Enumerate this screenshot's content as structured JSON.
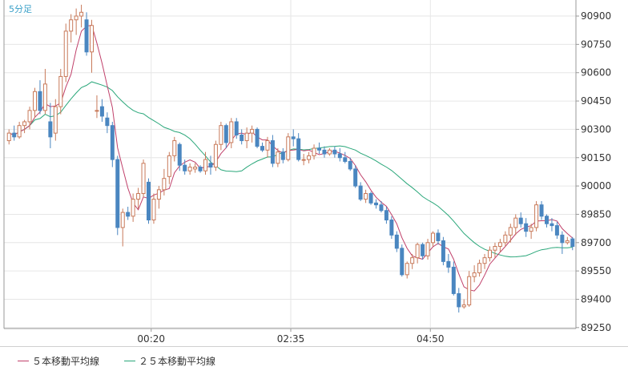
{
  "timeframe_label": "5分足",
  "legend": [
    {
      "label": "５本移動平均線",
      "color": "#c0406a"
    },
    {
      "label": "２５本移動平均線",
      "color": "#2aa77a"
    }
  ],
  "colors": {
    "up": "#c87a5a",
    "down": "#4a86c0",
    "grid": "#e6e6e6",
    "axis": "#9a9a9a"
  },
  "chart_data": {
    "type": "candlestick",
    "y_ticks": [
      90900,
      90750,
      90600,
      90450,
      90300,
      90150,
      90000,
      89850,
      89700,
      89550,
      89400,
      89250
    ],
    "ylim": [
      89245,
      90985
    ],
    "x_ticks": [
      {
        "label": "00:20",
        "index": 27.5
      },
      {
        "label": "02:35",
        "index": 54.5
      },
      {
        "label": "04:50",
        "index": 81.5
      }
    ],
    "candles": [
      [
        90240,
        90300,
        90220,
        90280
      ],
      [
        90280,
        90320,
        90240,
        90260
      ],
      [
        90260,
        90340,
        90250,
        90320
      ],
      [
        90320,
        90350,
        90280,
        90340
      ],
      [
        90340,
        90420,
        90300,
        90400
      ],
      [
        90400,
        90520,
        90360,
        90500
      ],
      [
        90500,
        90560,
        90380,
        90400
      ],
      [
        90400,
        90620,
        90380,
        90540
      ],
      [
        90340,
        90440,
        90200,
        90260
      ],
      [
        90280,
        90460,
        90240,
        90420
      ],
      [
        90420,
        90620,
        90380,
        90580
      ],
      [
        90580,
        90860,
        90550,
        90820
      ],
      [
        90820,
        90910,
        90760,
        90880
      ],
      [
        90880,
        90940,
        90800,
        90900
      ],
      [
        90900,
        90960,
        90840,
        90920
      ],
      [
        90880,
        90920,
        90690,
        90710
      ],
      [
        90710,
        90880,
        90600,
        90850
      ],
      [
        90400,
        90480,
        90360,
        90400
      ],
      [
        90420,
        90460,
        90340,
        90370
      ],
      [
        90360,
        90390,
        90280,
        90320
      ],
      [
        90320,
        90340,
        90100,
        90140
      ],
      [
        90140,
        90160,
        89740,
        89780
      ],
      [
        89780,
        89880,
        89680,
        89860
      ],
      [
        89860,
        89890,
        89820,
        89840
      ],
      [
        89840,
        89960,
        89810,
        89930
      ],
      [
        89930,
        89990,
        89880,
        89960
      ],
      [
        89960,
        90140,
        89940,
        90120
      ],
      [
        90020,
        90040,
        89800,
        89820
      ],
      [
        89820,
        89960,
        89800,
        89930
      ],
      [
        89930,
        90000,
        89880,
        89980
      ],
      [
        89980,
        90090,
        89950,
        90040
      ],
      [
        90050,
        90180,
        90010,
        90160
      ],
      [
        90160,
        90260,
        90130,
        90240
      ],
      [
        90220,
        90230,
        90080,
        90110
      ],
      [
        90110,
        90140,
        90060,
        90080
      ],
      [
        90080,
        90120,
        90060,
        90100
      ],
      [
        90090,
        90120,
        90070,
        90100
      ],
      [
        90100,
        90110,
        90070,
        90080
      ],
      [
        90080,
        90180,
        90060,
        90140
      ],
      [
        90120,
        90160,
        90060,
        90100
      ],
      [
        90100,
        90240,
        90080,
        90220
      ],
      [
        90220,
        90340,
        90190,
        90320
      ],
      [
        90320,
        90330,
        90200,
        90230
      ],
      [
        90230,
        90360,
        90200,
        90340
      ],
      [
        90340,
        90360,
        90250,
        90270
      ],
      [
        90270,
        90300,
        90220,
        90240
      ],
      [
        90240,
        90310,
        90200,
        90280
      ],
      [
        90280,
        90320,
        90230,
        90300
      ],
      [
        90300,
        90310,
        90200,
        90210
      ],
      [
        90210,
        90230,
        90180,
        90190
      ],
      [
        90190,
        90260,
        90150,
        90240
      ],
      [
        90240,
        90270,
        90100,
        90120
      ],
      [
        90120,
        90200,
        90100,
        90180
      ],
      [
        90180,
        90200,
        90120,
        90140
      ],
      [
        90140,
        90280,
        90130,
        90260
      ],
      [
        90260,
        90300,
        90210,
        90250
      ],
      [
        90250,
        90280,
        90130,
        90140
      ],
      [
        90140,
        90170,
        90110,
        90140
      ],
      [
        90140,
        90180,
        90120,
        90160
      ],
      [
        90160,
        90220,
        90140,
        90200
      ],
      [
        90200,
        90230,
        90170,
        90190
      ],
      [
        90190,
        90210,
        90150,
        90170
      ],
      [
        90170,
        90200,
        90160,
        90190
      ],
      [
        90190,
        90210,
        90150,
        90170
      ],
      [
        90170,
        90200,
        90130,
        90150
      ],
      [
        90150,
        90180,
        90120,
        90130
      ],
      [
        90130,
        90150,
        90080,
        90090
      ],
      [
        90090,
        90110,
        89990,
        90000
      ],
      [
        90000,
        90020,
        89920,
        89930
      ],
      [
        89930,
        89980,
        89910,
        89960
      ],
      [
        89960,
        89970,
        89900,
        89910
      ],
      [
        89910,
        89930,
        89880,
        89900
      ],
      [
        89900,
        89920,
        89860,
        89870
      ],
      [
        89870,
        89890,
        89800,
        89820
      ],
      [
        89820,
        89840,
        89720,
        89740
      ],
      [
        89740,
        89760,
        89650,
        89670
      ],
      [
        89670,
        89690,
        89520,
        89530
      ],
      [
        89530,
        89600,
        89510,
        89590
      ],
      [
        89590,
        89640,
        89560,
        89620
      ],
      [
        89620,
        89700,
        89590,
        89690
      ],
      [
        89690,
        89700,
        89610,
        89630
      ],
      [
        89630,
        89720,
        89610,
        89700
      ],
      [
        89700,
        89760,
        89680,
        89750
      ],
      [
        89750,
        89770,
        89690,
        89710
      ],
      [
        89710,
        89730,
        89580,
        89600
      ],
      [
        89600,
        89640,
        89540,
        89570
      ],
      [
        89570,
        89600,
        89420,
        89430
      ],
      [
        89430,
        89460,
        89330,
        89360
      ],
      [
        89360,
        89400,
        89350,
        89370
      ],
      [
        89370,
        89550,
        89360,
        89520
      ],
      [
        89520,
        89580,
        89490,
        89540
      ],
      [
        89540,
        89610,
        89520,
        89590
      ],
      [
        89590,
        89640,
        89560,
        89620
      ],
      [
        89620,
        89680,
        89600,
        89660
      ],
      [
        89660,
        89700,
        89620,
        89680
      ],
      [
        89680,
        89720,
        89650,
        89700
      ],
      [
        89700,
        89760,
        89680,
        89740
      ],
      [
        89740,
        89800,
        89700,
        89780
      ],
      [
        89780,
        89850,
        89740,
        89830
      ],
      [
        89830,
        89860,
        89780,
        89800
      ],
      [
        89800,
        89830,
        89730,
        89760
      ],
      [
        89760,
        89800,
        89720,
        89780
      ],
      [
        89780,
        89920,
        89760,
        89900
      ],
      [
        89900,
        89920,
        89820,
        89840
      ],
      [
        89840,
        89850,
        89780,
        89800
      ],
      [
        89800,
        89830,
        89760,
        89790
      ],
      [
        89790,
        89810,
        89720,
        89740
      ],
      [
        89740,
        89760,
        89640,
        89700
      ],
      [
        89700,
        89730,
        89690,
        89710
      ],
      [
        89720,
        89730,
        89660,
        89680
      ]
    ]
  }
}
